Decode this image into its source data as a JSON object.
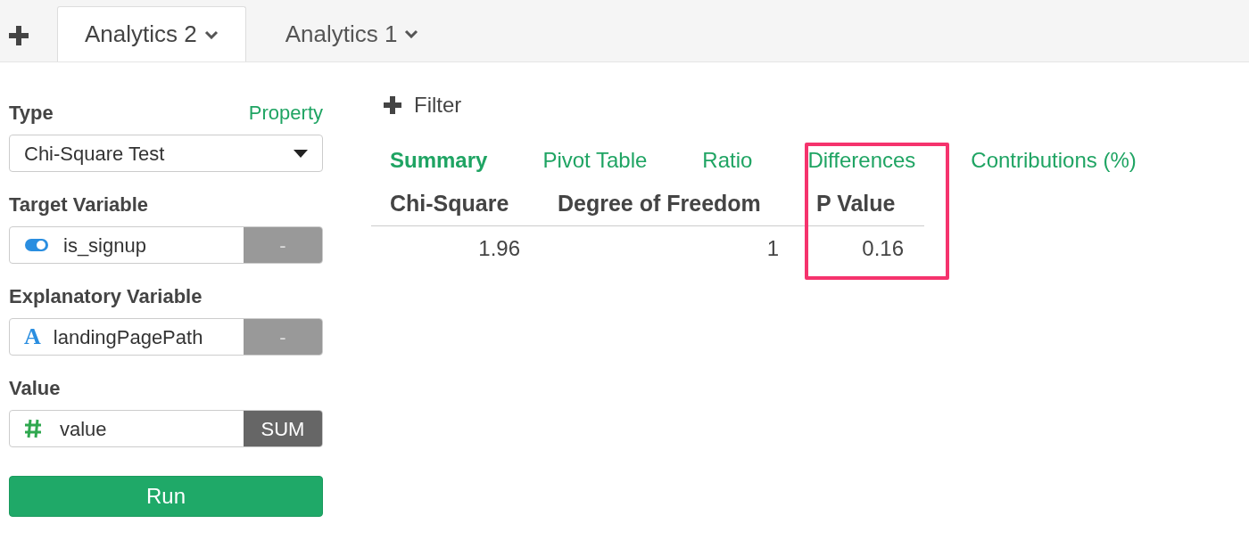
{
  "tabs": [
    {
      "label": "Analytics 2",
      "selected": true
    },
    {
      "label": "Analytics 1",
      "selected": false
    }
  ],
  "sidebar": {
    "type": {
      "label": "Type",
      "link": "Property",
      "value": "Chi-Square Test"
    },
    "fields": [
      {
        "label": "Target Variable",
        "kind": "toggle",
        "value": "is_signup",
        "action": "-",
        "action_active": false
      },
      {
        "label": "Explanatory Variable",
        "kind": "text",
        "icon": "A",
        "value": "landingPagePath",
        "action": "-",
        "action_active": false
      },
      {
        "label": "Value",
        "kind": "number",
        "value": "value",
        "action": "SUM",
        "action_active": true
      }
    ],
    "run": "Run"
  },
  "filter": "Filter",
  "result_tabs": [
    {
      "label": "Summary",
      "selected": true
    },
    {
      "label": "Pivot Table",
      "selected": false
    },
    {
      "label": "Ratio",
      "selected": false
    },
    {
      "label": "Differences",
      "selected": false
    },
    {
      "label": "Contributions (%)",
      "selected": false
    }
  ],
  "table": {
    "columns": [
      {
        "label": "Chi-Square",
        "highlighted": false
      },
      {
        "label": "Degree of Freedom",
        "highlighted": false
      },
      {
        "label": "P Value",
        "highlighted": true
      }
    ],
    "rows": [
      [
        "1.96",
        "1",
        "0.16"
      ]
    ]
  }
}
